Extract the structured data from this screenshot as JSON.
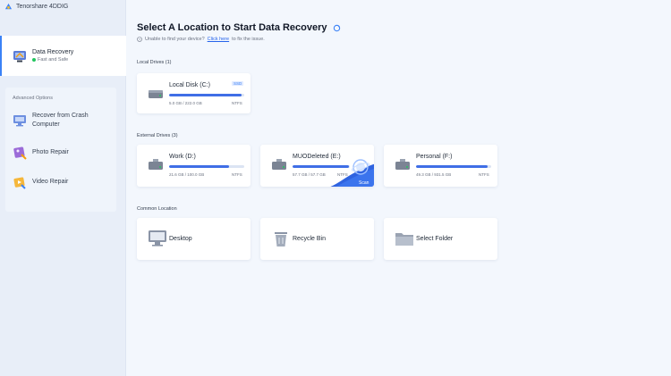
{
  "app": {
    "name": "Tenorshare 4DDIG"
  },
  "sidebar": {
    "active": {
      "label": "Data Recovery",
      "status": "Fast and Safe"
    },
    "advanced_title": "Advanced Options",
    "items": [
      {
        "label_line1": "Recover from Crash",
        "label_line2": "Computer",
        "icon": "monitor-icon"
      },
      {
        "label": "Photo Repair",
        "icon": "photo-repair-icon"
      },
      {
        "label": "Video Repair",
        "icon": "video-repair-icon"
      }
    ]
  },
  "main": {
    "title": "Select A Location to Start Data Recovery",
    "help": {
      "prefix": "Unable to find your device?",
      "link": "Click here",
      "suffix": "to fix the issue."
    },
    "local_title": "Local Drives (1)",
    "external_title": "External Drives (3)",
    "common_title": "Common Location",
    "local_drives": [
      {
        "name": "Local Disk (C:)",
        "size": "5.0 GB / 222.0 GB",
        "fs": "NTFS",
        "badge": "SSD",
        "usage": 0.97
      }
    ],
    "external_drives": [
      {
        "name": "Work (D:)",
        "size": "21.6 GB / 100.0 GB",
        "fs": "NTFS",
        "usage": 0.8
      },
      {
        "name": "MUODeleted (E:)",
        "size": "57.7 GB / 57.7 GB",
        "fs": "NTFS",
        "usage": 0.98,
        "scan_label": "Scan"
      },
      {
        "name": "Personal (F:)",
        "size": "49.3 GB / 931.5 GB",
        "fs": "NTFS",
        "usage": 0.95
      }
    ],
    "common_locations": [
      {
        "name": "Desktop",
        "icon": "desktop-icon"
      },
      {
        "name": "Recycle Bin",
        "icon": "recycle-bin-icon"
      },
      {
        "name": "Select Folder",
        "icon": "folder-icon"
      }
    ]
  },
  "colors": {
    "accent": "#3f6ee6",
    "sidebar_bg": "#e8eef8",
    "main_bg": "#f3f7fd"
  }
}
